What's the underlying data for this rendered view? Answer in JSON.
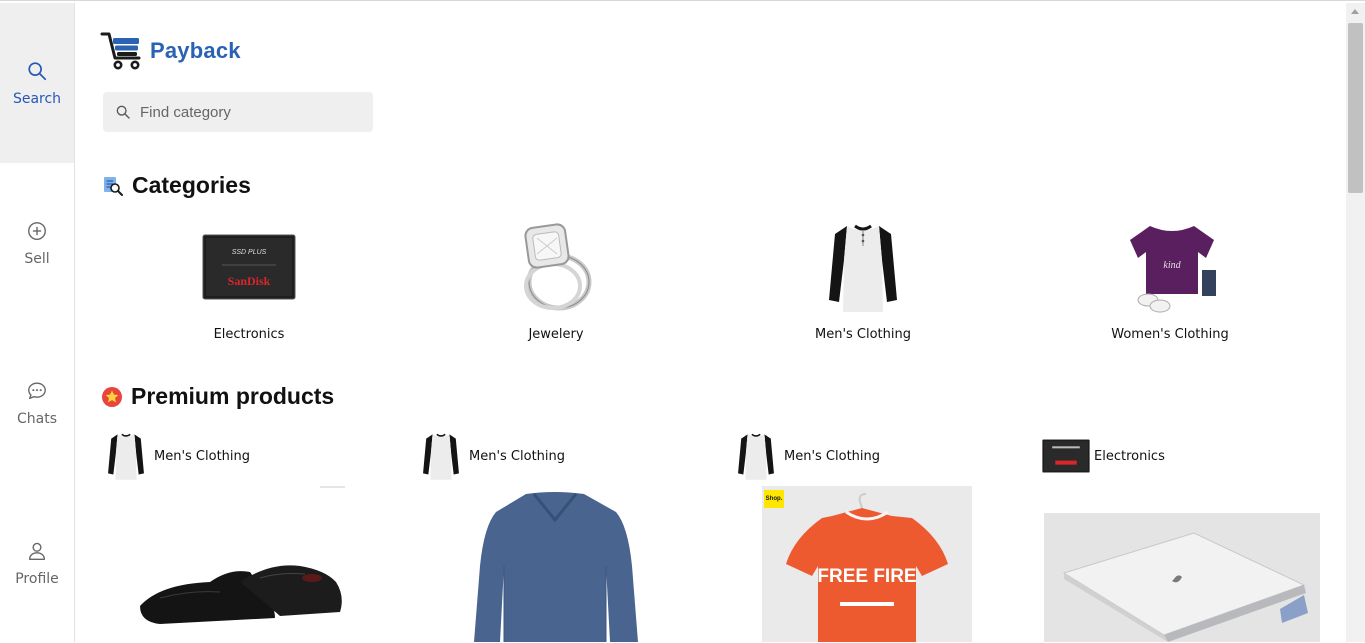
{
  "nav": {
    "items": [
      {
        "label": "Search",
        "icon": "search-icon"
      },
      {
        "label": "Sell",
        "icon": "plus-circle-icon"
      },
      {
        "label": "Chats",
        "icon": "chat-icon"
      },
      {
        "label": "Profile",
        "icon": "user-icon"
      }
    ],
    "active": "Search"
  },
  "brand": {
    "name": "Payback",
    "color": "#2a63b3"
  },
  "search": {
    "placeholder": "Find category"
  },
  "categories": {
    "title": "Categories",
    "items": [
      {
        "name": "Electronics"
      },
      {
        "name": "Jewelery"
      },
      {
        "name": "Men's Clothing"
      },
      {
        "name": "Women's Clothing"
      }
    ]
  },
  "premium": {
    "title": "Premium products",
    "products": [
      {
        "category": "Men's Clothing",
        "image": "black-oxford-shoes"
      },
      {
        "category": "Men's Clothing",
        "image": "blue-long-sleeve-shirt"
      },
      {
        "category": "Men's Clothing",
        "image": "orange-free-fire-tshirt"
      },
      {
        "category": "Electronics",
        "image": "silver-laptop"
      }
    ]
  },
  "tshirt_print": "FREE FIRE",
  "ssd_label": "SanDisk",
  "ssd_sub": "SSD PLUS",
  "shop_badge": "Shop."
}
